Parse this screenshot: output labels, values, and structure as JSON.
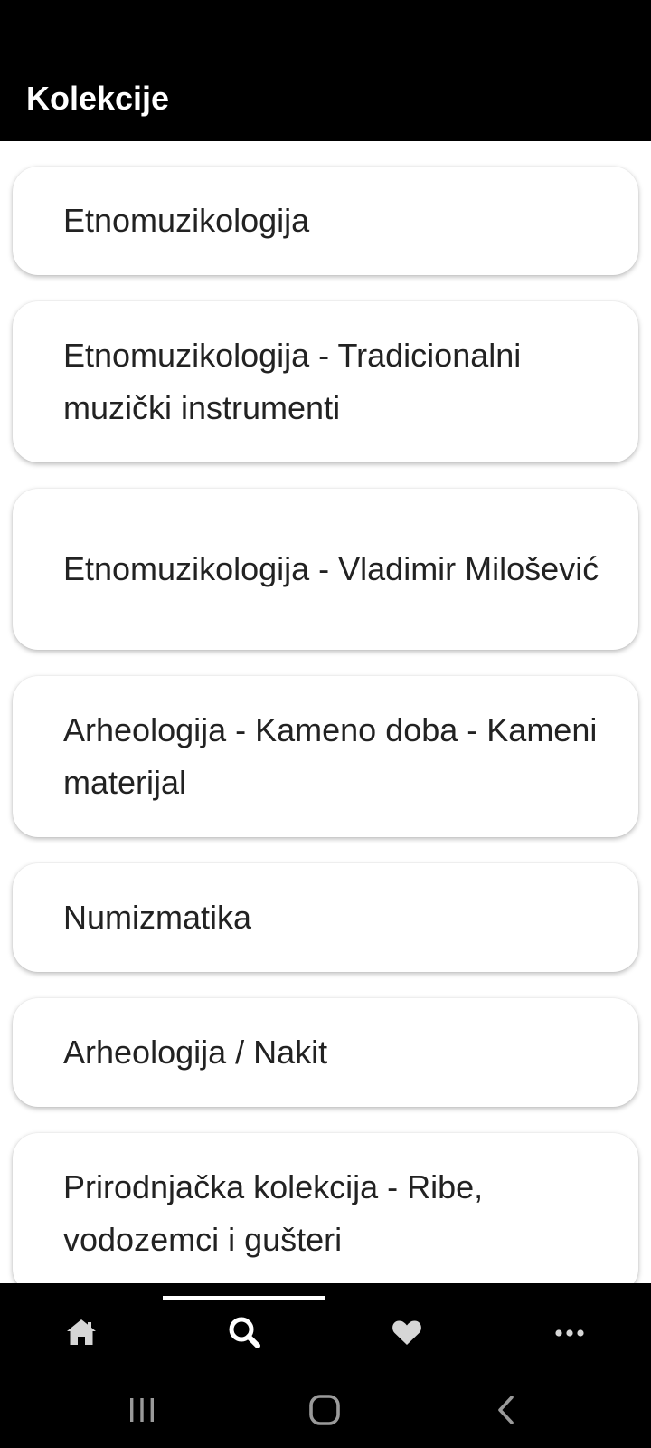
{
  "header": {
    "title": "Kolekcije"
  },
  "collections": [
    {
      "label": "Etnomuzikologija"
    },
    {
      "label": "Etnomuzikologija - Tradicionalni muzički instrumenti"
    },
    {
      "label": "Etnomuzikologija - Vladimir Milošević"
    },
    {
      "label": "Arheologija - Kameno doba - Kameni materijal"
    },
    {
      "label": "Numizmatika"
    },
    {
      "label": "Arheologija / Nakit"
    },
    {
      "label": "Prirodnjačka kolekcija - Ribe, vodozemci i gušteri"
    }
  ],
  "bottom_nav": {
    "items": [
      {
        "icon": "home-icon",
        "selected": false
      },
      {
        "icon": "search-icon",
        "selected": true
      },
      {
        "icon": "heart-icon",
        "selected": false
      },
      {
        "icon": "more-icon",
        "selected": false
      }
    ]
  },
  "system_nav": {
    "buttons": [
      {
        "icon": "recents-icon"
      },
      {
        "icon": "home-circle-icon"
      },
      {
        "icon": "back-icon"
      }
    ]
  },
  "colors": {
    "bar_background": "#000000",
    "page_background": "#ffffff",
    "card_text": "#222222",
    "selected_icon": "#ffffff",
    "unselected_icon": "#d6d6d6"
  }
}
